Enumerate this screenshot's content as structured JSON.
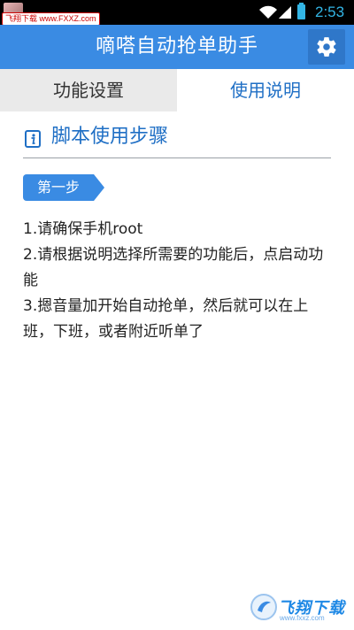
{
  "status_bar": {
    "watermark": "飞翔下载 www.FXXZ.com",
    "time": "2:53",
    "icons": [
      "wifi-icon",
      "signal-icon",
      "battery-icon"
    ]
  },
  "app_bar": {
    "title": "嘀嗒自动抢单助手",
    "settings_icon": "gear-icon"
  },
  "tabs": [
    {
      "label": "功能设置",
      "active": false
    },
    {
      "label": "使用说明",
      "active": true
    }
  ],
  "section": {
    "icon": "info-icon",
    "title": "脚本使用步骤"
  },
  "step": {
    "label": "第一步"
  },
  "instructions": [
    "1.请确保手机root",
    "2.请根据说明选择所需要的功能后，点启动功能",
    "3.摁音量加开始自动抢单，然后就可以在上班，下班，或者附近听单了"
  ],
  "watermark_bottom": {
    "text": "飞翔下载",
    "sub": "www.fxxz.com"
  },
  "colors": {
    "primary": "#3a8be3",
    "accent_text": "#1f6fc5",
    "clock": "#33b5e5"
  }
}
